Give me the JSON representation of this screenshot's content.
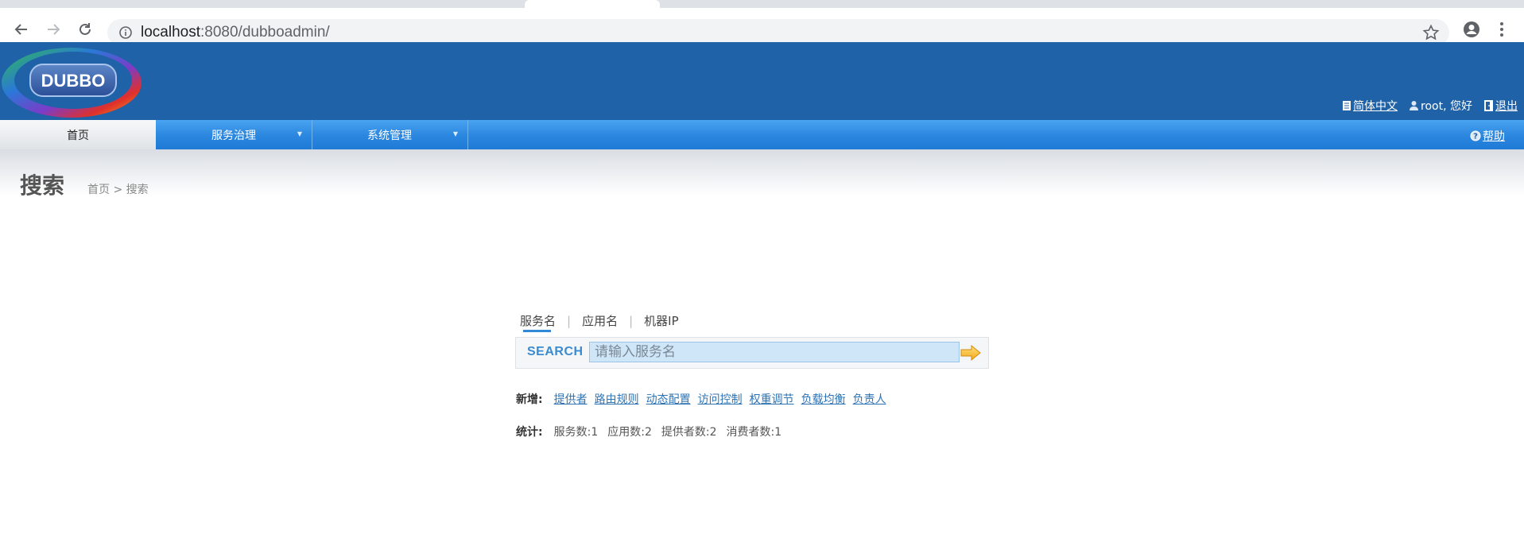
{
  "browser": {
    "url_host": "localhost",
    "url_rest": ":8080/dubboadmin/"
  },
  "header": {
    "logo_text": "DUBBO",
    "language": "简体中文",
    "user_greeting": "root, 您好",
    "logout": "退出"
  },
  "nav": {
    "items": [
      {
        "label": "首页"
      },
      {
        "label": "服务治理"
      },
      {
        "label": "系统管理"
      }
    ],
    "help": "帮助"
  },
  "page": {
    "title": "搜索",
    "breadcrumb": "首页 > 搜索"
  },
  "search": {
    "tabs": [
      {
        "label": "服务名"
      },
      {
        "label": "应用名"
      },
      {
        "label": "机器IP"
      }
    ],
    "label": "SEARCH",
    "placeholder": "请输入服务名"
  },
  "quick_add": {
    "label": "新增:",
    "links": [
      {
        "label": "提供者"
      },
      {
        "label": "路由规则"
      },
      {
        "label": "动态配置"
      },
      {
        "label": "访问控制"
      },
      {
        "label": "权重调节"
      },
      {
        "label": "负载均衡"
      },
      {
        "label": "负责人"
      }
    ]
  },
  "stats": {
    "label": "统计:",
    "items": [
      {
        "text": "服务数:1"
      },
      {
        "text": "应用数:2"
      },
      {
        "text": "提供者数:2"
      },
      {
        "text": "消费者数:1"
      }
    ]
  },
  "colors": {
    "header_bg": "#1f62a7",
    "nav_bg": "#2a86de",
    "link": "#2e74b5",
    "search_accent": "#3b8bd0"
  }
}
